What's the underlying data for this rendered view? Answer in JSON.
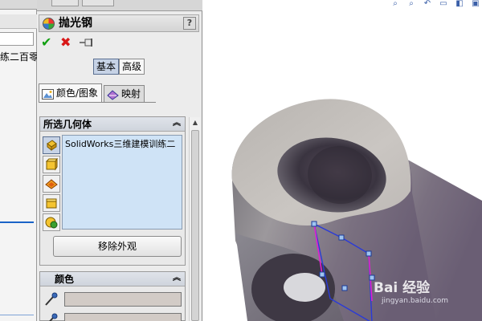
{
  "feature_tree": {
    "collapse_glyph": "»",
    "cut_text": "练二百零"
  },
  "property_manager": {
    "title": "抛光钢",
    "help_label": "?",
    "mode_buttons": [
      {
        "label": "基本",
        "active": true
      },
      {
        "label": "高级",
        "active": false
      }
    ],
    "tabs": [
      {
        "label": "颜色/图象",
        "icon": "image-icon",
        "active": true
      },
      {
        "label": "映射",
        "icon": "mapping-icon",
        "active": false
      }
    ],
    "selected_geometry": {
      "title": "所选几何体",
      "collapse_glyph": "^",
      "filters": [
        "part-filter-icon",
        "body-filter-icon",
        "feature-filter-icon",
        "face-filter-icon",
        "display-state-icon"
      ],
      "items": [
        "SolidWorks三维建模训练二"
      ],
      "remove_button": "移除外观"
    },
    "color": {
      "title": "颜色",
      "collapse_glyph": "^",
      "swatch_color": "#d2cbc6"
    }
  },
  "viewport": {
    "watermark_main": "Bai 经验",
    "watermark_sub": "jingyan.baidu.com"
  }
}
